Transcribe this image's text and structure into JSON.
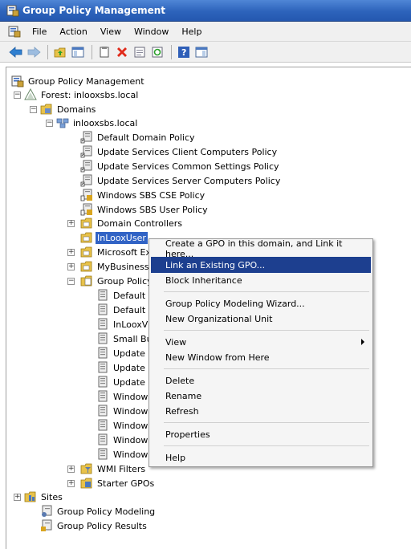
{
  "window": {
    "title": "Group Policy Management"
  },
  "menubar": {
    "items": [
      "File",
      "Action",
      "View",
      "Window",
      "Help"
    ]
  },
  "toolbar": {
    "icons": [
      "back-icon",
      "forward-icon",
      "up-folder-icon",
      "show-hide-tree-icon",
      "copy-icon",
      "delete-icon",
      "properties-icon",
      "refresh-icon",
      "help-icon",
      "show-action-pane-icon"
    ]
  },
  "tree": {
    "root": "Group Policy Management",
    "forest": "Forest: inlooxsbs.local",
    "domains": "Domains",
    "domain": "inlooxsbs.local",
    "links": [
      "Default Domain Policy",
      "Update Services Client Computers Policy",
      "Update Services Common Settings Policy",
      "Update Services Server Computers Policy",
      "Windows SBS CSE Policy",
      "Windows SBS User Policy"
    ],
    "domain_controllers": "Domain Controllers",
    "inloox_user": "InLooxUser",
    "microsoft_ex": "Microsoft Ex",
    "mybusiness": "MyBusiness",
    "gpo_container": "Group Policy",
    "gpos": [
      "Default",
      "Default",
      "InLooxV",
      "Small Bu",
      "Update",
      "Update",
      "Update",
      "Window",
      "Window",
      "Window",
      "Window",
      "Window"
    ],
    "wmi_filters": "WMI Filters",
    "starter_gpos": "Starter GPOs",
    "sites": "Sites",
    "modeling": "Group Policy Modeling",
    "results": "Group Policy Results"
  },
  "context_menu": {
    "items": [
      "Create a GPO in this domain, and Link it here...",
      "Link an Existing GPO...",
      "Block Inheritance",
      "Group Policy Modeling Wizard...",
      "New Organizational Unit",
      "View",
      "New Window from Here",
      "Delete",
      "Rename",
      "Refresh",
      "Properties",
      "Help"
    ],
    "highlighted": "Link an Existing GPO..."
  },
  "colors": {
    "titlebar": "#2d63bb",
    "selection": "#3163c5",
    "menu_highlight": "#1d3f8f"
  }
}
